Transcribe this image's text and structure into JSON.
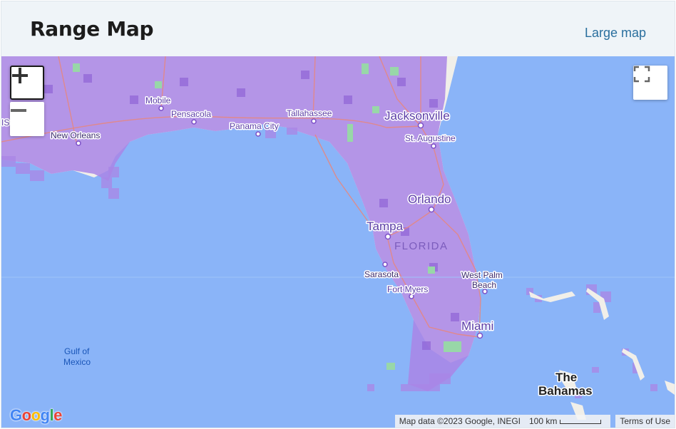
{
  "header": {
    "title": "Range Map",
    "large_map_link": "Large map"
  },
  "map": {
    "colors": {
      "water": "#8ab4f8",
      "land": "#f1efe9",
      "range": "#a985e6",
      "range_dark": "#9a6fe0",
      "park": "#98d7a8",
      "road": "#e8867c"
    },
    "places": {
      "jacksonville": "Jacksonville",
      "st_augustine": "St. Augustine",
      "tallahassee": "Tallahassee",
      "mobile": "Mobile",
      "pensacola": "Pensacola",
      "panama_city": "Panama City",
      "new_orleans": "New Orleans",
      "orlando": "Orlando",
      "tampa": "Tampa",
      "florida": "FLORIDA",
      "sarasota": "Sarasota",
      "fort_myers": "Fort Myers",
      "west_palm_beach_1": "West Palm",
      "west_palm_beach_2": "Beach",
      "miami": "Miami",
      "gulf_1": "Gulf of",
      "gulf_2": "Mexico",
      "bahamas_1": "The",
      "bahamas_2": "Bahamas",
      "edge_label": "IS"
    },
    "attribution": {
      "map_data": "Map data ©2023 Google, INEGI",
      "scale": "100 km",
      "terms": "Terms of Use"
    },
    "logo": {
      "letters": [
        "G",
        "o",
        "o",
        "g",
        "l",
        "e"
      ],
      "colors": [
        "#4285f4",
        "#ea4335",
        "#fbbc05",
        "#4285f4",
        "#34a853",
        "#ea4335"
      ]
    }
  }
}
